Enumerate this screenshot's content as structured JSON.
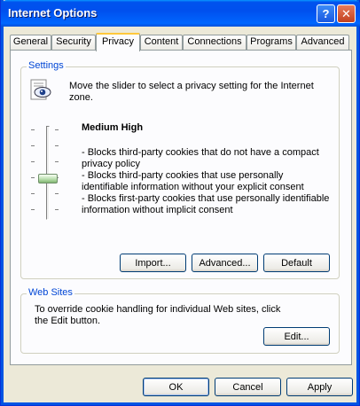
{
  "window": {
    "title": "Internet Options",
    "help_glyph": "?",
    "close_glyph": "✕"
  },
  "tabs": [
    {
      "label": "General"
    },
    {
      "label": "Security"
    },
    {
      "label": "Privacy",
      "active": true
    },
    {
      "label": "Content"
    },
    {
      "label": "Connections"
    },
    {
      "label": "Programs"
    },
    {
      "label": "Advanced"
    }
  ],
  "settings": {
    "legend": "Settings",
    "instruction": "Move the slider to select a privacy setting for the Internet zone.",
    "level_title": "Medium High",
    "descriptions": [
      "- Blocks third-party cookies that do not have a compact privacy policy",
      "- Blocks third-party cookies that use personally identifiable information without your explicit consent",
      "- Blocks first-party cookies that use personally identifiable information without implicit consent"
    ],
    "slider": {
      "positions": 6,
      "selected_index": 3
    },
    "import_label": "Import...",
    "advanced_label": "Advanced...",
    "default_label": "Default"
  },
  "websites": {
    "legend": "Web Sites",
    "text": "To override cookie handling for individual Web sites, click the Edit button.",
    "edit_label": "Edit..."
  },
  "footer": {
    "ok_label": "OK",
    "cancel_label": "Cancel",
    "apply_label": "Apply"
  },
  "colors": {
    "title_bar": "#0054e3",
    "group_legend": "#0046d5",
    "active_tab_highlight": "#ffc83c",
    "dialog_background": "#ece9d8"
  },
  "icons": {
    "privacy": "privacy-eye-icon",
    "help": "help-icon",
    "close": "close-icon"
  }
}
